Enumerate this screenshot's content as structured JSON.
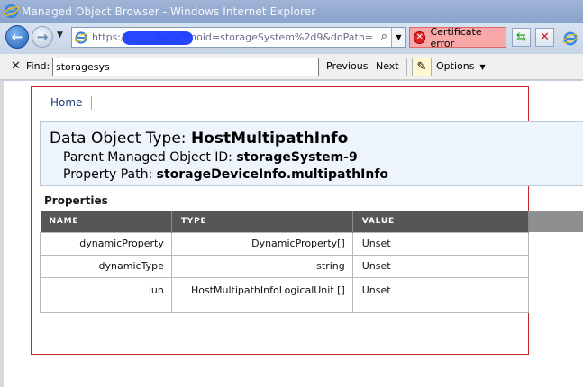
{
  "window": {
    "title": "Managed Object Browser - Windows Internet Explorer"
  },
  "address_bar": {
    "url": "https://mob/?moid=storageSystem%2d9&doPath=",
    "url_prefix": "https://",
    "url_suffix": "mob/?moid=storageSystem%2d9&doPath=",
    "certificate_error": "Certificate error"
  },
  "find_bar": {
    "label": "Find:",
    "query": "storagesys",
    "previous": "Previous",
    "next": "Next",
    "options": "Options"
  },
  "page": {
    "home": "Home",
    "data_object_type_label": "Data Object Type:",
    "data_object_type": "HostMultipathInfo",
    "parent_label": "Parent Managed Object ID:",
    "parent_id": "storageSystem-9",
    "path_label": "Property Path:",
    "path": "storageDeviceInfo.multipathInfo",
    "properties_heading": "Properties",
    "table": {
      "headers": [
        "NAME",
        "TYPE",
        "VALUE"
      ],
      "rows": [
        {
          "name": "dynamicProperty",
          "type": "DynamicProperty[]",
          "value": "Unset"
        },
        {
          "name": "dynamicType",
          "type": "string",
          "value": "Unset"
        },
        {
          "name": "lun",
          "type": "HostMultipathInfoLogicalUnit []",
          "value": "Unset"
        }
      ]
    }
  },
  "colors": {
    "frame_border": "#c42a2a",
    "header_bg": "#eef4fb",
    "table_header_bg": "#565656",
    "cert_error_bg": "#f8a8a8"
  },
  "icons": [
    "ie-logo-icon",
    "back-arrow-icon",
    "forward-arrow-icon",
    "search-icon",
    "shield-error-icon",
    "refresh-icon",
    "stop-icon",
    "close-icon",
    "highlight-pen-icon"
  ]
}
